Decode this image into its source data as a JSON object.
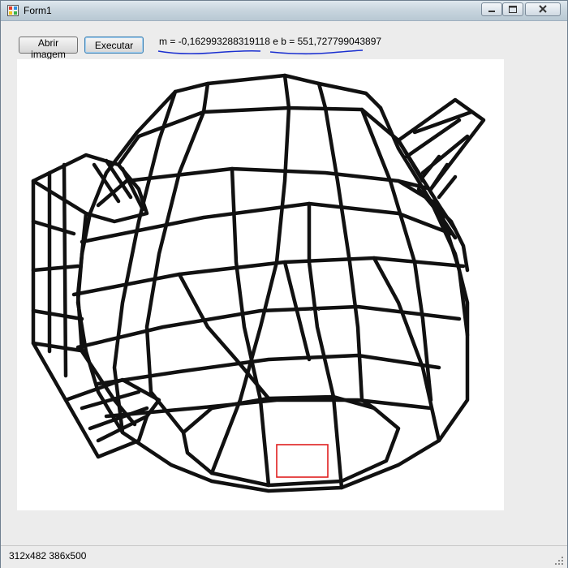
{
  "window": {
    "title": "Form1"
  },
  "toolbar": {
    "open_label": "Abrir imagem",
    "execute_label": "Executar"
  },
  "formula": {
    "m_text": "m = -0,162993288319118",
    "connector": "e",
    "b_text": "b = 551,727799043897"
  },
  "status": {
    "text": "312x482  386x500"
  },
  "colors": {
    "wire": "#111111",
    "highlight": "#e02020",
    "annotation": "#1a2fd0"
  },
  "icons": {
    "app": "app-icon",
    "minimize": "minimize-icon",
    "maximize": "maximize-icon",
    "close": "close-icon"
  }
}
